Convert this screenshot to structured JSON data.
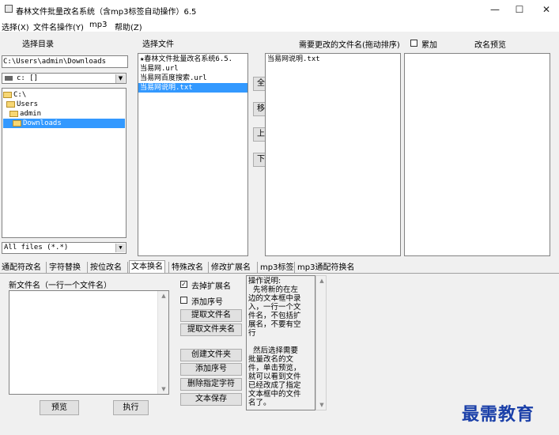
{
  "window": {
    "title": "春林文件批量改名系统（含mp3标签自动操作）6.5",
    "controls": {
      "minimize": "—",
      "maximize": "☐",
      "close": "✕"
    }
  },
  "menu": [
    "选择(X)",
    "文件名操作(Y)",
    "mp3",
    "帮助(Z)"
  ],
  "headers": {
    "select_dir": "选择目录",
    "select_file": "选择文件",
    "rename_list": "需要更改的文件名(拖动排序)",
    "accumulate": "累加",
    "preview": "改名预览"
  },
  "dir_path": "C:\\Users\\admin\\Downloads",
  "drive": "c: []",
  "tree": [
    "C:\\",
    "Users",
    "admin",
    "Downloads"
  ],
  "file_filter": "All files (*.*)",
  "files": [
    "★春林文件批量改名系统6.5.",
    "当易网.url",
    "当易网百度搜索.url",
    "当易网说明.txt"
  ],
  "rename_files": [
    "当易网说明.txt"
  ],
  "mid_buttons": [
    "全选",
    "移出",
    "上移",
    "下移"
  ],
  "tabs": [
    "通配符改名",
    "字符替换",
    "按位改名",
    "文本换名",
    "特殊改名",
    "修改扩展名",
    "mp3标签",
    "mp3通配符换名"
  ],
  "active_tab": "文本换名",
  "new_name_label": "新文件名（一行一个文件名）",
  "options": {
    "remove_ext": {
      "label": "去掉扩展名",
      "checked": true
    },
    "add_seq": {
      "label": "添加序号",
      "checked": false
    }
  },
  "side_buttons": [
    "提取文件名",
    "提取文件夹名",
    "创建文件夹",
    "添加序号",
    "删除指定字符",
    "文本保存"
  ],
  "help_text": "操作说明:\n  先将新的在左边的文本框中录入，一行一个文件名，不包括扩展名，不要有空行\n\n  然后选择需要批量改名的文件，单击预览，就可以看到文件已经改成了指定文本框中的文件名了。",
  "bottom_buttons": {
    "preview": "预览",
    "execute": "执行"
  },
  "watermark": "最需教育"
}
